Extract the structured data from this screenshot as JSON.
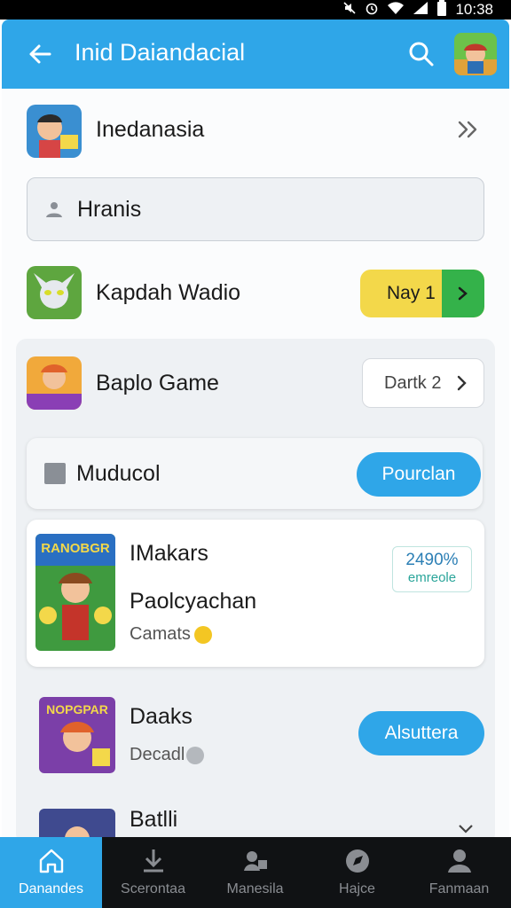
{
  "status_bar": {
    "time": "10:38",
    "icons": [
      "mute-icon",
      "alarm-icon",
      "wifi-icon",
      "signal-icon",
      "battery-icon"
    ]
  },
  "app_bar": {
    "title": "Inid Daiandacial",
    "back_icon": "arrow-left-icon",
    "search_icon": "search-icon"
  },
  "list": {
    "row1": {
      "label": "Inedanasia",
      "chevron": "double-chevron-right-icon"
    },
    "search_field": {
      "value": "Hranis"
    },
    "row2": {
      "label": "Kapdah Wadio",
      "button_label": "Nay 1"
    },
    "row3": {
      "label": "Baplo Game",
      "button_label": "Dartk 2"
    },
    "row4": {
      "label": "Muducol",
      "button_label": "Pourclan"
    },
    "card": {
      "thumb_text": "RANOBGR",
      "title": "IMakars",
      "subtitle": "Paolcyachan",
      "meta": "Camats",
      "badge_line1": "2490%",
      "badge_line2": "emreole"
    },
    "row5": {
      "thumb_text": "NOPGPAR",
      "title": "Daaks",
      "meta": "Decadl",
      "button_label": "Alsuttera"
    },
    "row6": {
      "title": "Batlli"
    }
  },
  "bottom_nav": [
    {
      "label": "Danandes",
      "icon": "home-icon",
      "active": true
    },
    {
      "label": "Scerontaa",
      "icon": "download-icon",
      "active": false
    },
    {
      "label": "Manesila",
      "icon": "library-icon",
      "active": false
    },
    {
      "label": "Hajce",
      "icon": "compass-icon",
      "active": false
    },
    {
      "label": "Fanmaan",
      "icon": "person-icon",
      "active": false
    }
  ],
  "colors": {
    "primary": "#2fa6e8",
    "yellow": "#f3d84a",
    "green": "#34b24a",
    "badge_teal": "#2aa59a",
    "nav_bg": "#101214"
  }
}
